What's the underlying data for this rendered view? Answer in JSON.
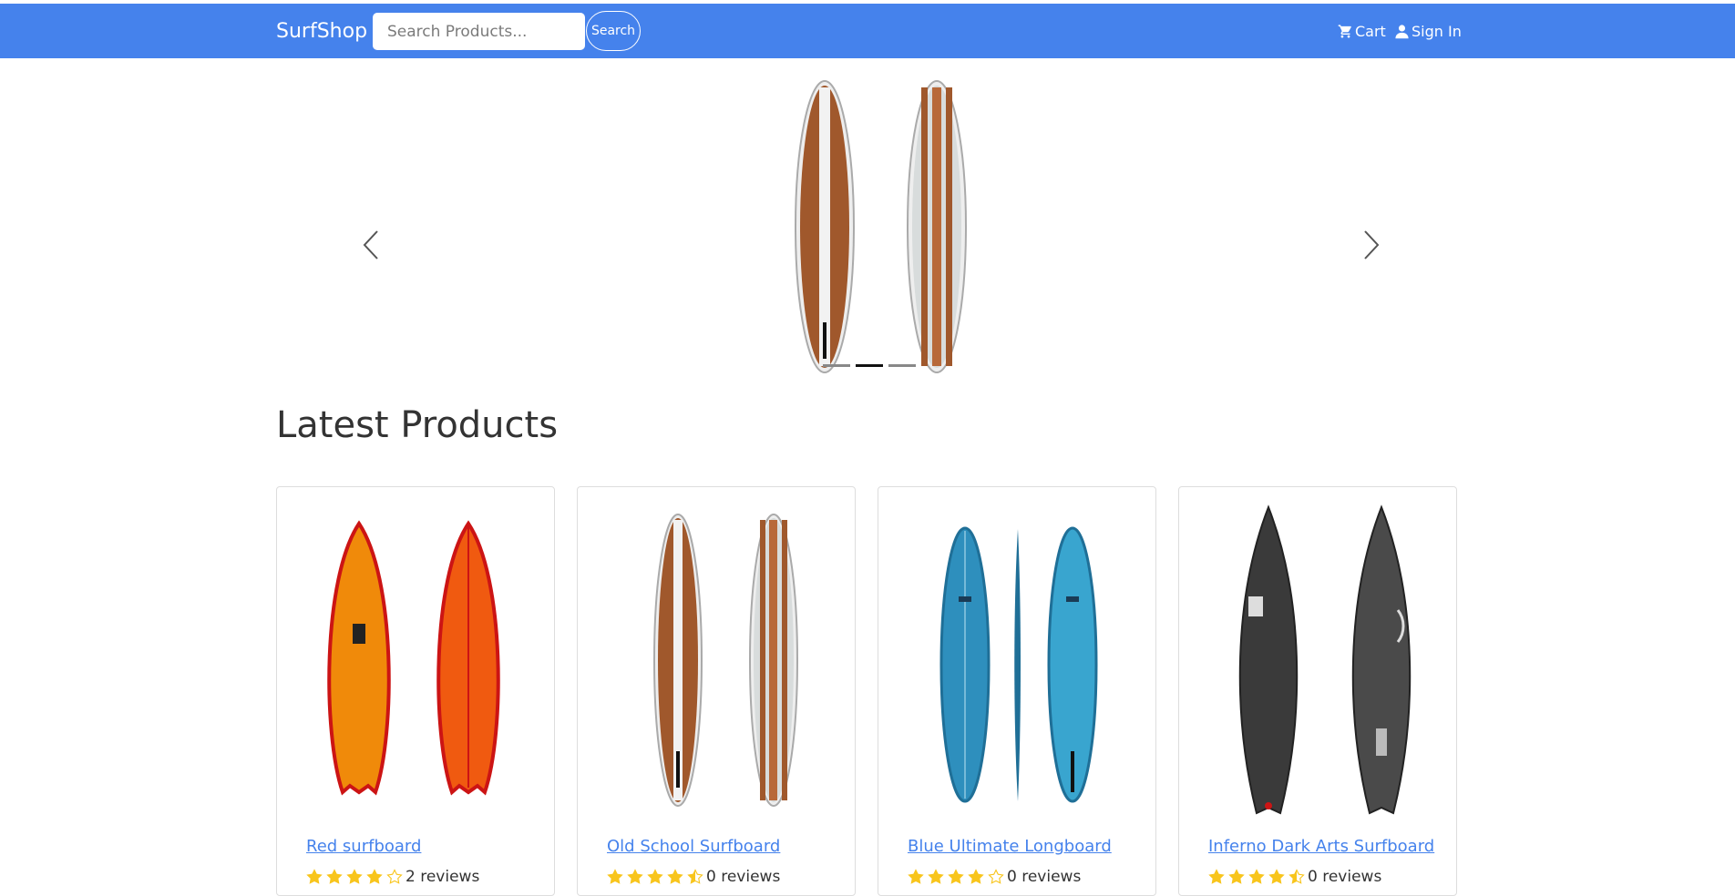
{
  "nav": {
    "brand": "SurfShop",
    "search_placeholder": "Search Products...",
    "search_button": "Search",
    "cart": "Cart",
    "sign_in": "Sign In",
    "color": "#4582ec"
  },
  "carousel": {
    "slide_count": 3,
    "active_index": 1,
    "prev_icon": "chevron-left-icon",
    "next_icon": "chevron-right-icon"
  },
  "main": {
    "heading": "Latest Products",
    "products": [
      {
        "name": "Red surfboard",
        "rating": 4,
        "reviews": "2 reviews"
      },
      {
        "name": "Old School Surfboard",
        "rating": 4.5,
        "reviews": "0 reviews"
      },
      {
        "name": "Blue Ultimate Longboard",
        "rating": 4,
        "reviews": "0 reviews"
      },
      {
        "name": "Inferno Dark Arts Surfboard",
        "rating": 4.5,
        "reviews": "0 reviews"
      }
    ]
  },
  "colors": {
    "star": "#f8c51c",
    "link": "#4582ec"
  }
}
